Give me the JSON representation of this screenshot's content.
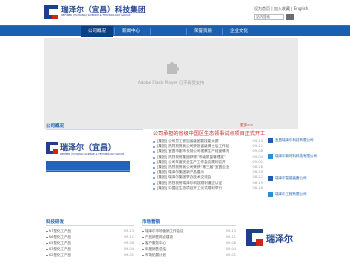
{
  "header": {
    "logo_cn": "瑞泽尔（宜昌）科技集团",
    "logo_en": "REFINER (YICHANG) SCIENCE & TECHNOLOGY GROUP",
    "top_links": "设为首页 | 加入收藏 | English",
    "search_placeholder": "站内搜索"
  },
  "nav": {
    "items": [
      "公司概况",
      "新闻中心",
      "",
      "荣誉资质",
      "企业文化"
    ]
  },
  "flash": {
    "plugin_text": "Adobe Flash Player 已不再受支持"
  },
  "profile": {
    "heading": "公司概况",
    "logo_cn": "瑞泽尔（宜昌）",
    "logo_en": "REFINER (YICHANG) SCIENCE & TECHNOLOGY GROUP"
  },
  "news": {
    "more_label": "更多>>",
    "headline": "公司承担的省级中国区生态领事试点项目正式开工",
    "items": [
      {
        "title": "[集团] 公司员工参加省级团委技能大赛",
        "date": "09-13"
      },
      {
        "title": "[集团] 热烈祝贺我公司获批省级博士后工作站",
        "date": "09-11"
      },
      {
        "title": "[集团] 宜昌市副市长到公司视察生产经营情况",
        "date": "09-08"
      },
      {
        "title": "[集团] 热烈祝贺集团获得“市级质量管理奖”",
        "date": "09-04"
      },
      {
        "title": "[集团] 公司年度安全生产工作会议顺利召开",
        "date": "09-01"
      },
      {
        "title": "[集团] 热烈祝贺我公司荣获“第三届”宜昌企业",
        "date": "08-28"
      },
      {
        "title": "[集团] 瑞泽尔集团新产品展示",
        "date": "08-25"
      },
      {
        "title": "[集团] 瑞泽尔集团举办技术交流会",
        "date": "08-22"
      },
      {
        "title": "[集团] 热烈祝贺瑞泽尔科技顺利通过认证",
        "date": "08-19"
      },
      {
        "title": "[集团] 中国区生态项目开工仪式顺利举行",
        "date": "08-16"
      }
    ]
  },
  "right_rail": {
    "items": [
      "宜昌瑞泽尔科技有限公司",
      "瑞泽尔新材料科技有限公司",
      "瑞泽尔智能装备公司",
      "瑞泽尔工程有限公司"
    ]
  },
  "product": {
    "heading": "科技研发",
    "items": [
      {
        "title": "K7型化工产品",
        "date": "09-13"
      },
      {
        "title": "K6型化工产品",
        "date": "09-11"
      },
      {
        "title": "K5型化工产品",
        "date": "09-08"
      },
      {
        "title": "K3型化工产品",
        "date": "09-04"
      },
      {
        "title": "K2型化工产品",
        "date": "09-01"
      }
    ]
  },
  "market": {
    "heading": "市场营销",
    "items": [
      {
        "title": "瑞泽尔市场营销工作会议",
        "date": "09-13"
      },
      {
        "title": "产品销售网点建设",
        "date": "09-11"
      },
      {
        "title": "客户服务中心",
        "date": "09-08"
      },
      {
        "title": "年度销售总结",
        "date": "09-04"
      },
      {
        "title": "市场拓展计划",
        "date": "09-01"
      }
    ]
  },
  "bottom_logo": "瑞泽尔"
}
